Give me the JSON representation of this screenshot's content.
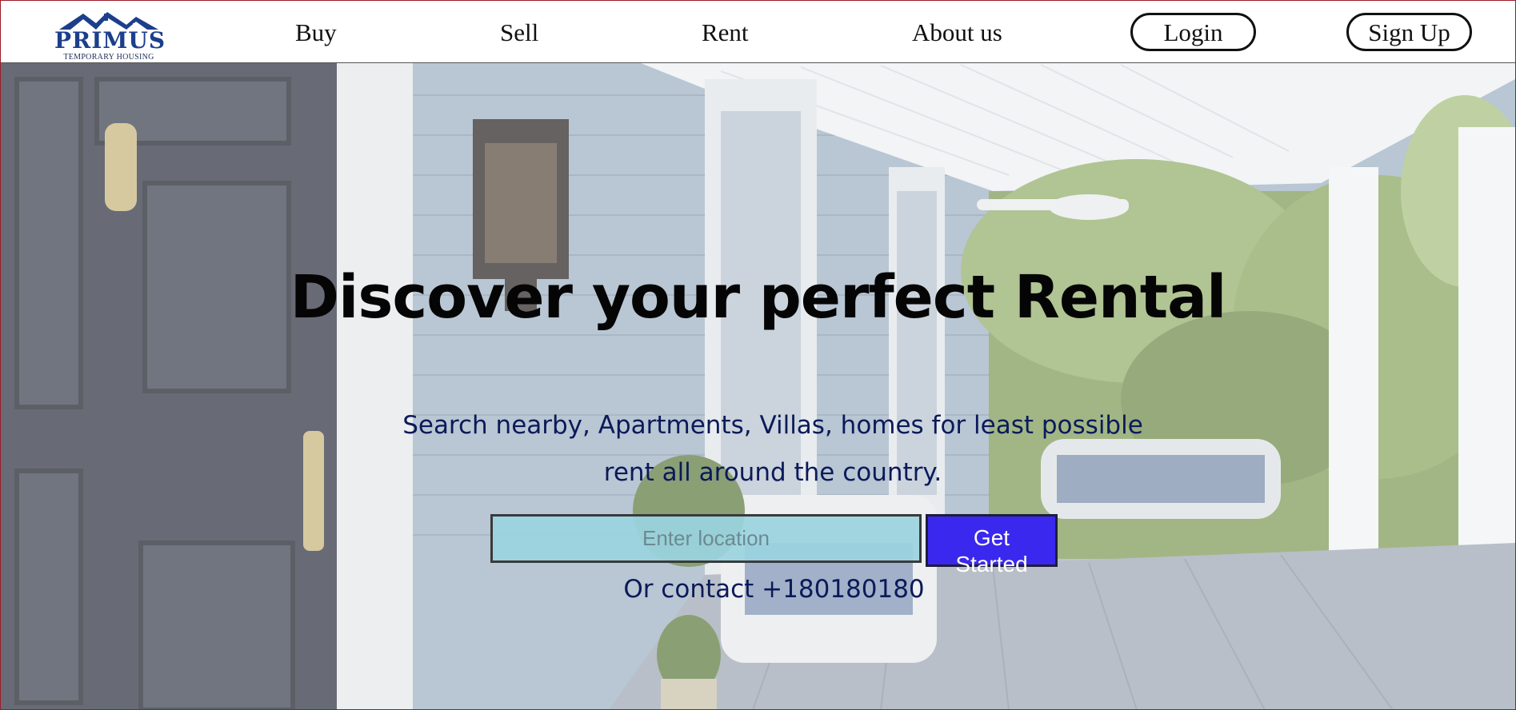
{
  "brand": {
    "logo_word": "PRIMUS",
    "logo_sub": "TEMPORARY HOUSING",
    "primary_color": "#1c3f8c"
  },
  "nav": {
    "links": [
      "Buy",
      "Sell",
      "Rent",
      "About us"
    ],
    "login_label": "Login",
    "signup_label": "Sign Up"
  },
  "hero": {
    "title": "Discover your perfect Rental",
    "subtitle_line1": "Search nearby, Apartments, Villas, homes for least possible",
    "subtitle_line2": "rent all around the country.",
    "search_placeholder": "Enter location",
    "search_value": "",
    "cta_label": "Get Started",
    "cta_color": "#3b28ee",
    "contact": "Or contact +180180180"
  }
}
